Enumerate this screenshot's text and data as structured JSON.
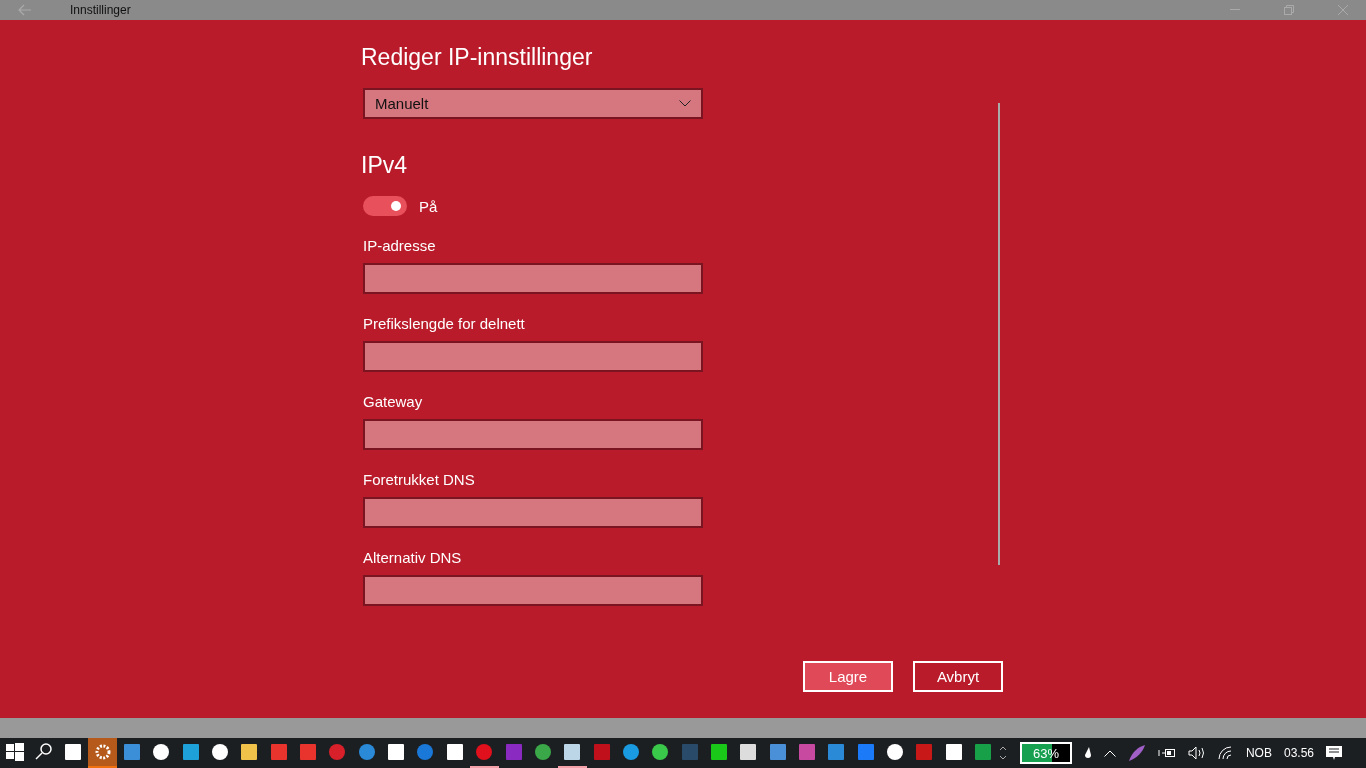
{
  "window": {
    "title": "Innstillinger"
  },
  "heading": "Rediger IP-innstillinger",
  "mode_dropdown": {
    "value": "Manuelt"
  },
  "section": "IPv4",
  "toggle": {
    "on": true,
    "label": "På"
  },
  "fields": [
    {
      "label": "IP-adresse"
    },
    {
      "label": "Prefikslengde for delnett"
    },
    {
      "label": "Gateway"
    },
    {
      "label": "Foretrukket DNS"
    },
    {
      "label": "Alternativ DNS"
    }
  ],
  "buttons": [
    {
      "label": "Lagre",
      "kind": "primary"
    },
    {
      "label": "Avbryt",
      "kind": "secondary"
    }
  ],
  "taskbar": {
    "apps": [
      {
        "running": false,
        "selected": false
      },
      {
        "running": false,
        "selected": false
      },
      {
        "running": false,
        "selected": false
      },
      {
        "running": true,
        "selected": true
      },
      {
        "running": false,
        "selected": false
      },
      {
        "running": false,
        "selected": false
      },
      {
        "running": false,
        "selected": false
      },
      {
        "running": false,
        "selected": false
      },
      {
        "running": false,
        "selected": false
      },
      {
        "running": false,
        "selected": false
      },
      {
        "running": false,
        "selected": false
      },
      {
        "running": false,
        "selected": false
      },
      {
        "running": false,
        "selected": false
      },
      {
        "running": false,
        "selected": false
      },
      {
        "running": false,
        "selected": false
      },
      {
        "running": false,
        "selected": false
      },
      {
        "running": true,
        "selected": false
      },
      {
        "running": false,
        "selected": false
      },
      {
        "running": false,
        "selected": false
      },
      {
        "running": true,
        "selected": false
      },
      {
        "running": false,
        "selected": false
      },
      {
        "running": false,
        "selected": false
      },
      {
        "running": false,
        "selected": false
      },
      {
        "running": false,
        "selected": false
      },
      {
        "running": false,
        "selected": false
      },
      {
        "running": false,
        "selected": false
      },
      {
        "running": false,
        "selected": false
      },
      {
        "running": false,
        "selected": false
      },
      {
        "running": false,
        "selected": false
      },
      {
        "running": false,
        "selected": false
      },
      {
        "running": false,
        "selected": false
      },
      {
        "running": false,
        "selected": false
      },
      {
        "running": false,
        "selected": false
      },
      {
        "running": false,
        "selected": false
      }
    ],
    "battery": "63%",
    "language": "NOB",
    "time": "03.56"
  }
}
